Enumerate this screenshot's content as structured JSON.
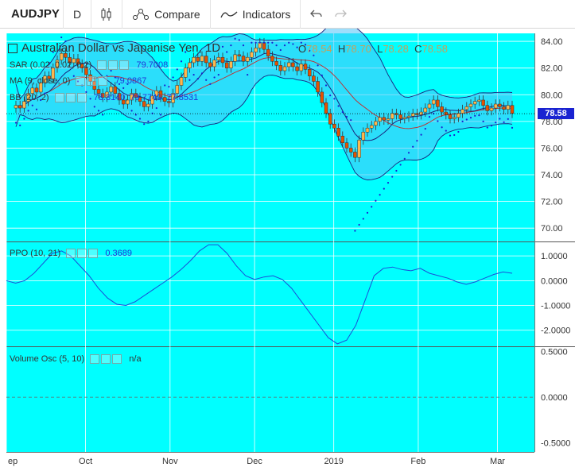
{
  "toolbar": {
    "symbol": "AUDJPY",
    "interval": "D",
    "chart_style_icon": "candles-icon",
    "compare_label": "Compare",
    "indicators_label": "Indicators",
    "undo_icon": "undo-icon",
    "redo_icon": "redo-icon"
  },
  "colors": {
    "background": "#00ffff",
    "up": "#ffb74d",
    "down": "#e65100",
    "bb_fill": "#4fc3f7",
    "bb_band": "#1a237e",
    "sar": "#1a23d1",
    "ma": "#c62828",
    "ppo": "#1a4fd8",
    "last_price_tag": "#1a23d1"
  },
  "main_pane": {
    "title": "Australian Dollar vs Japanise Yen, 1D",
    "ohlc": {
      "o_label": "O",
      "o": "78.54",
      "h_label": "H",
      "h": "78.70",
      "l_label": "L",
      "l": "78.28",
      "c_label": "C",
      "c": "78.58"
    },
    "sar": {
      "label": "SAR (0.02, 0.02, 0.2)",
      "value": "79.7008"
    },
    "ma": {
      "label": "MA (9, close, 0)",
      "value": "79.0867"
    },
    "bb": {
      "label": "BB (20, 2)",
      "value1": "78.8140",
      "value2": "79.7749",
      "value3": "77.8531"
    },
    "last_price": "78.58"
  },
  "ppo_pane": {
    "label": "PPO (10, 21)",
    "value": "0.3689"
  },
  "vol_pane": {
    "label": "Volume Osc (5, 10)",
    "value": "n/a"
  },
  "chart_data": [
    {
      "type": "candlestick",
      "title": "Australian Dollar vs Japanise Yen, 1D",
      "x_tick_labels": [
        "ep",
        "Oct",
        "Nov",
        "Dec",
        "2019",
        "Feb",
        "Mar"
      ],
      "y_tick_labels": [
        "70.00",
        "72.00",
        "74.00",
        "76.00",
        "78.00",
        "80.00",
        "82.00",
        "84.00"
      ],
      "ylim": [
        69.0,
        84.6
      ],
      "close": [
        79.2,
        79.0,
        79.5,
        80.1,
        80.5,
        80.2,
        80.9,
        81.4,
        81.2,
        82.0,
        82.6,
        83.1,
        82.8,
        82.4,
        82.7,
        82.3,
        82.0,
        81.5,
        81.0,
        80.4,
        80.1,
        79.8,
        80.2,
        80.6,
        80.1,
        79.6,
        79.3,
        79.6,
        80.1,
        79.8,
        79.5,
        79.1,
        79.3,
        79.9,
        80.3,
        79.8,
        79.5,
        79.4,
        80.1,
        80.7,
        81.3,
        82.0,
        82.4,
        82.8,
        82.5,
        82.9,
        82.4,
        82.1,
        82.6,
        82.8,
        82.4,
        82.0,
        82.5,
        83.0,
        82.9,
        82.5,
        82.8,
        83.2,
        83.5,
        83.9,
        83.4,
        82.9,
        82.5,
        82.2,
        81.8,
        82.1,
        82.4,
        82.1,
        81.8,
        82.3,
        81.9,
        81.4,
        81.0,
        80.2,
        79.4,
        78.6,
        77.8,
        77.5,
        76.9,
        76.4,
        76.0,
        75.7,
        75.3,
        76.6,
        77.2,
        77.5,
        77.7,
        78.0,
        78.3,
        78.1,
        78.2,
        78.6,
        78.5,
        78.2,
        78.3,
        78.4,
        78.6,
        78.5,
        78.7,
        79.0,
        79.3,
        79.6,
        79.1,
        78.7,
        78.5,
        78.2,
        78.3,
        78.6,
        78.9,
        79.1,
        79.3,
        79.5,
        79.6,
        79.2,
        78.8,
        79.0,
        79.3,
        79.1,
        78.9,
        79.2,
        78.6
      ],
      "sar_range": [
        69.8,
        83.9
      ],
      "bb_note": "upper/lower band + basis shaded"
    },
    {
      "type": "line",
      "name": "PPO (10, 21)",
      "y_tick_labels": [
        "1.0000",
        "0.0000",
        "-1.0000",
        "-2.0000"
      ],
      "ylim": [
        -2.65,
        1.55
      ],
      "values": [
        0.0,
        -0.1,
        0.0,
        0.3,
        0.7,
        1.1,
        1.2,
        1.0,
        0.6,
        0.2,
        -0.3,
        -0.7,
        -0.95,
        -1.0,
        -0.85,
        -0.6,
        -0.35,
        -0.1,
        0.15,
        0.45,
        0.8,
        1.2,
        1.45,
        1.45,
        1.1,
        0.6,
        0.2,
        0.05,
        0.15,
        0.2,
        0.05,
        -0.3,
        -0.8,
        -1.3,
        -1.8,
        -2.3,
        -2.55,
        -2.4,
        -1.8,
        -0.8,
        0.2,
        0.5,
        0.55,
        0.45,
        0.4,
        0.5,
        0.3,
        0.2,
        0.1,
        -0.05,
        -0.15,
        -0.05,
        0.1,
        0.25,
        0.35,
        0.3
      ]
    },
    {
      "type": "line",
      "name": "Volume Osc (5, 10)",
      "y_tick_labels": [
        "0.5000",
        "0.0000",
        "-0.5000"
      ],
      "ylim": [
        -0.6,
        0.55
      ]
    }
  ]
}
